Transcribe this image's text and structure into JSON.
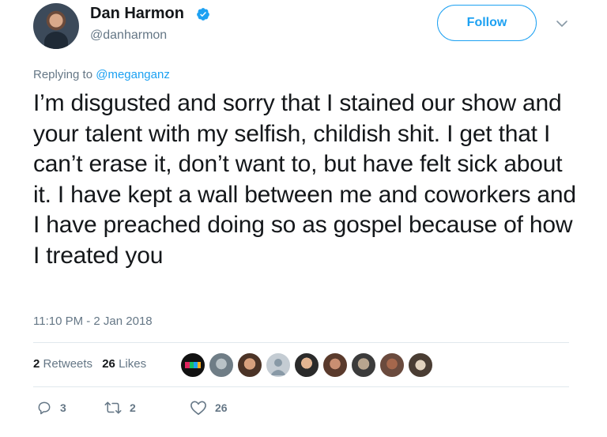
{
  "user": {
    "display_name": "Dan Harmon",
    "handle": "@danharmon"
  },
  "follow_label": "Follow",
  "reply_context": {
    "prefix": "Replying to ",
    "mention": "@meganganz"
  },
  "tweet_text": "I’m disgusted and sorry that I stained our show and your talent with my selfish, childish shit. I get that I can’t erase it, don’t want to, but have felt sick about it. I have kept a wall between me and coworkers and I have preached doing so as gospel because of how I treated you",
  "timestamp": "11:10 PM - 2 Jan 2018",
  "stats": {
    "retweets_count": "2",
    "retweets_label": "Retweets",
    "likes_count": "26",
    "likes_label": "Likes"
  },
  "actions": {
    "replies": "3",
    "retweets": "2",
    "likes": "26"
  },
  "icons": [
    "verified-badge-icon",
    "chevron-down-icon",
    "reply-icon",
    "retweet-icon",
    "heart-icon"
  ],
  "colors": {
    "accent": "#1da1f2",
    "text": "#14171a",
    "secondary": "#657786",
    "divider": "#e1e8ed"
  }
}
